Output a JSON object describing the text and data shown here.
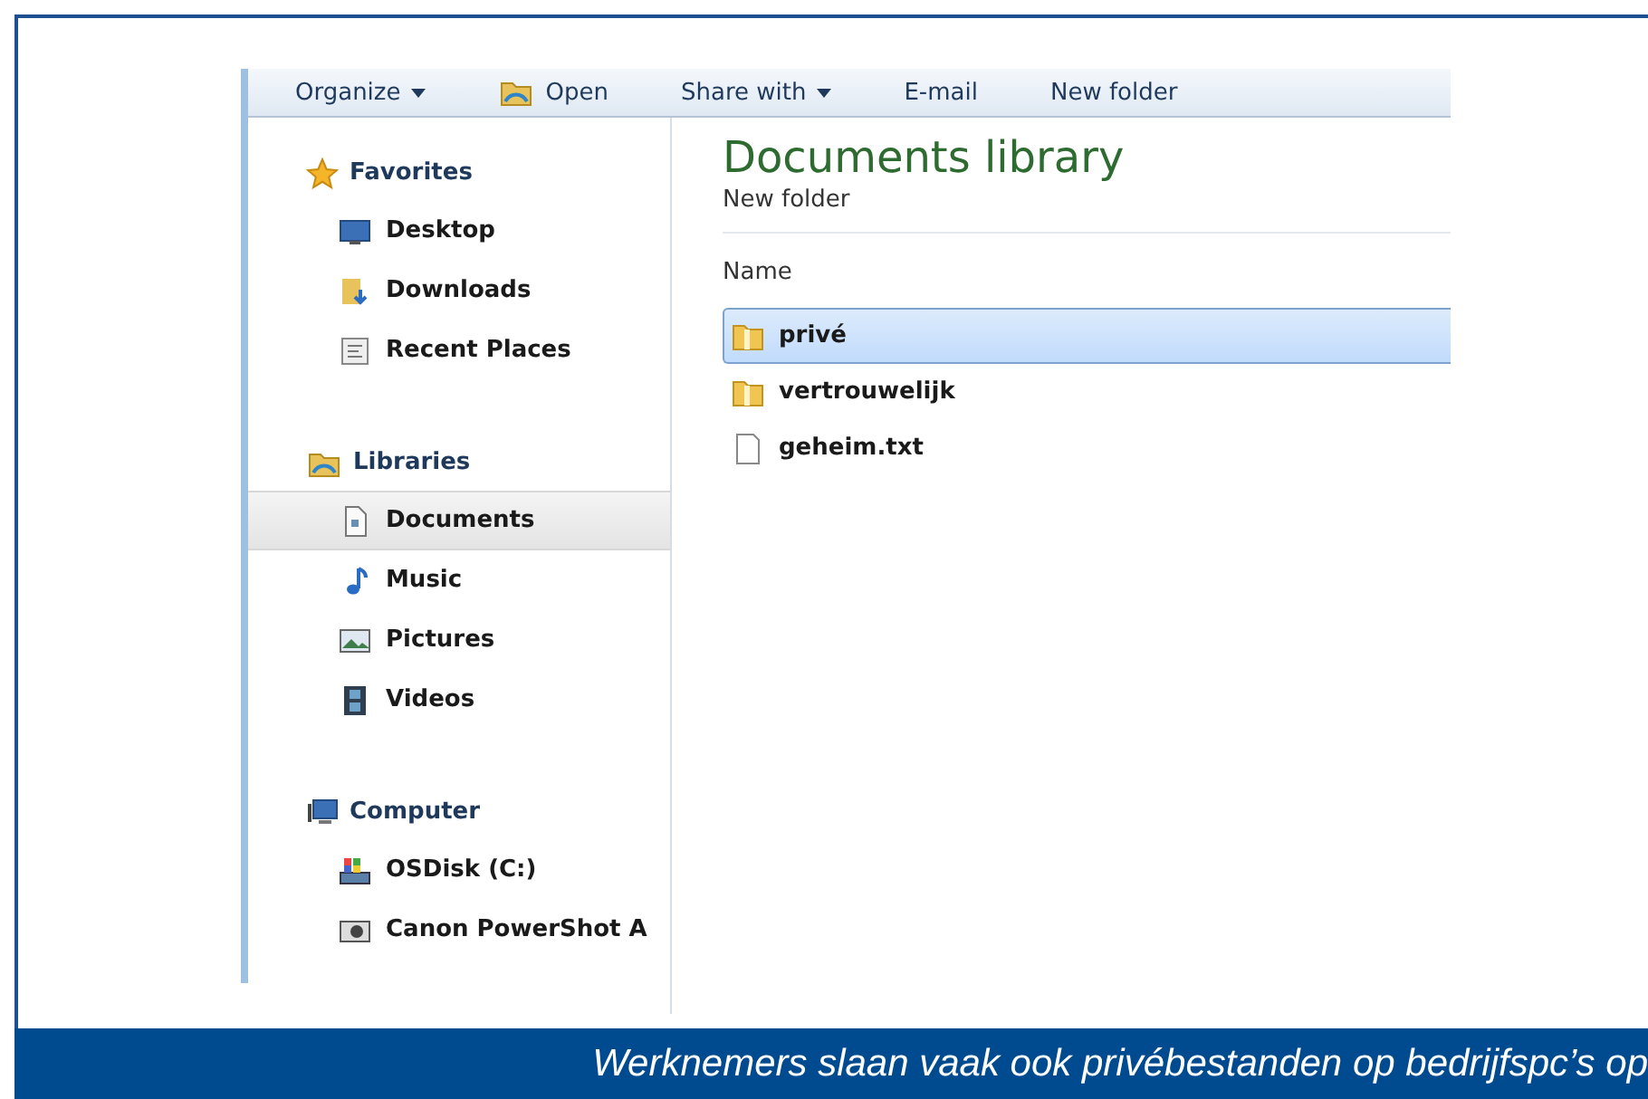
{
  "toolbar": [
    {
      "label": "Organize",
      "kind": "menu"
    },
    {
      "label": "Open",
      "kind": "open"
    },
    {
      "label": "Share with",
      "kind": "menu"
    },
    {
      "label": "E-mail",
      "kind": "plain"
    },
    {
      "label": "New folder",
      "kind": "plain"
    }
  ],
  "sidebar": {
    "groups": [
      {
        "label": "Favorites",
        "kind": "star",
        "children": [
          {
            "label": "Desktop",
            "kind": "desktop",
            "selected": false
          },
          {
            "label": "Downloads",
            "kind": "downloads",
            "selected": false
          },
          {
            "label": "Recent Places",
            "kind": "recent",
            "selected": false
          }
        ]
      },
      {
        "label": "Libraries",
        "kind": "library",
        "children": [
          {
            "label": "Documents",
            "kind": "document",
            "selected": true
          },
          {
            "label": "Music",
            "kind": "music",
            "selected": false
          },
          {
            "label": "Pictures",
            "kind": "pictures",
            "selected": false
          },
          {
            "label": "Videos",
            "kind": "videos",
            "selected": false
          }
        ]
      },
      {
        "label": "Computer",
        "kind": "computer",
        "children": [
          {
            "label": "OSDisk (C:)",
            "kind": "disk",
            "selected": false
          },
          {
            "label": "Canon PowerShot A",
            "kind": "camera",
            "selected": false
          }
        ]
      }
    ]
  },
  "content": {
    "title": "Documents library",
    "subtitle": "New folder",
    "column_header": "Name",
    "files": [
      {
        "name": "privé",
        "kind": "folder",
        "selected": true
      },
      {
        "name": "vertrouwelijk",
        "kind": "folder",
        "selected": false
      },
      {
        "name": "geheim.txt",
        "kind": "text",
        "selected": false
      }
    ]
  },
  "caption": "Werknemers slaan vaak ook privébestanden op bedrijfspc’s op"
}
